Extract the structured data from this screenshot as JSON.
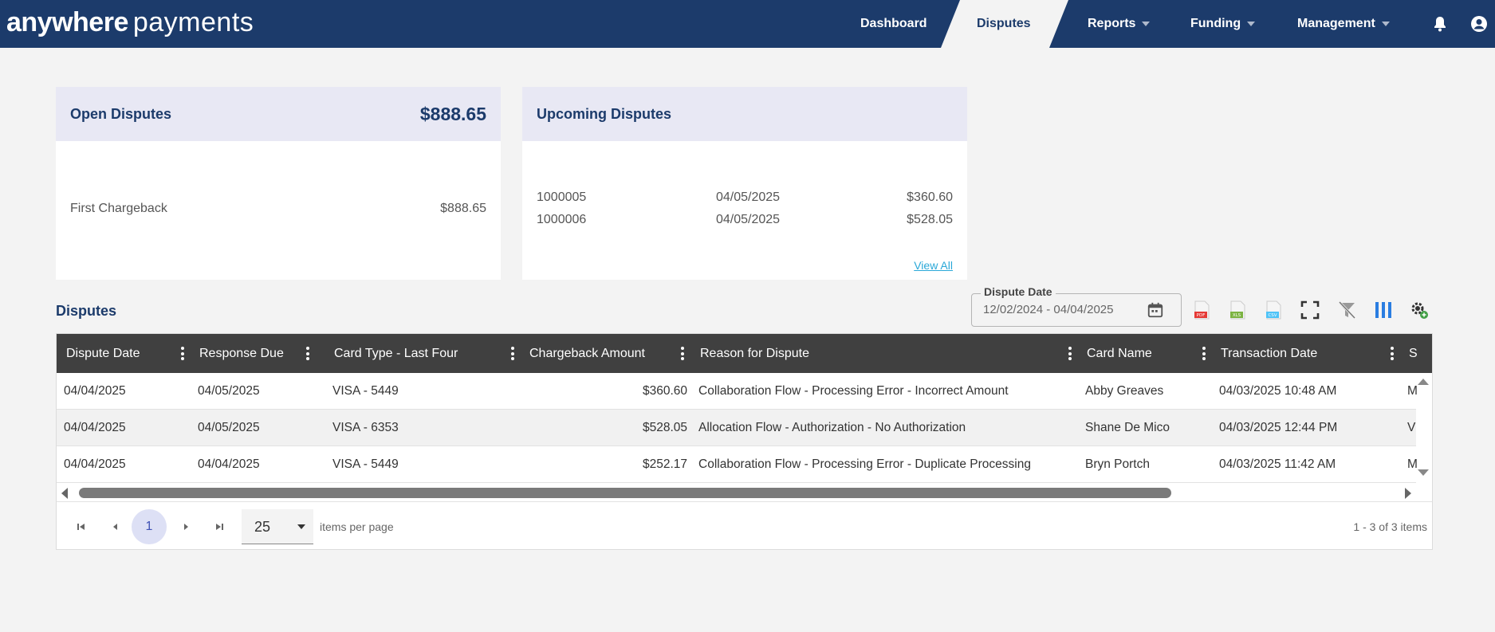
{
  "brand": {
    "bold": "anywhere",
    "light": "payments"
  },
  "nav": {
    "items": [
      {
        "label": "Dashboard"
      },
      {
        "label": "Disputes"
      },
      {
        "label": "Reports"
      },
      {
        "label": "Funding"
      },
      {
        "label": "Management"
      }
    ],
    "icons": [
      "bell-icon",
      "user-icon"
    ]
  },
  "open_disputes": {
    "title": "Open Disputes",
    "total": "$888.65",
    "rows": [
      {
        "label": "First Chargeback",
        "amount": "$888.65"
      }
    ]
  },
  "upcoming_disputes": {
    "title": "Upcoming Disputes",
    "rows": [
      {
        "id": "1000005",
        "date": "04/05/2025",
        "amount": "$360.60"
      },
      {
        "id": "1000006",
        "date": "04/05/2025",
        "amount": "$528.05"
      }
    ],
    "view_all": "View All"
  },
  "disputes": {
    "title": "Disputes",
    "date_filter": {
      "label": "Dispute Date",
      "value": "12/02/2024 - 04/04/2025"
    },
    "toolbar": [
      "pdf-export-icon",
      "xls-export-icon",
      "csv-export-icon",
      "fullscreen-icon",
      "clear-filter-icon",
      "columns-icon",
      "settings-icon"
    ],
    "columns": [
      "Dispute Date",
      "Response Due",
      "Card Type - Last Four",
      "Chargeback Amount",
      "Reason for Dispute",
      "Card Name",
      "Transaction Date",
      "S"
    ],
    "rows": [
      [
        "04/04/2025",
        "04/05/2025",
        "VISA - 5449",
        "$360.60",
        "Collaboration Flow - Processing Error - Incorrect Amount",
        "Abby Greaves",
        "04/03/2025 10:48 AM",
        "M"
      ],
      [
        "04/04/2025",
        "04/05/2025",
        "VISA - 6353",
        "$528.05",
        "Allocation Flow - Authorization - No Authorization",
        "Shane De Mico",
        "04/03/2025 12:44 PM",
        "V"
      ],
      [
        "04/04/2025",
        "04/04/2025",
        "VISA - 5449",
        "$252.17",
        "Collaboration Flow - Processing Error - Duplicate Processing",
        "Bryn Portch",
        "04/03/2025 11:42 AM",
        "M"
      ]
    ]
  },
  "pager": {
    "current_page": "1",
    "page_size": "25",
    "items_per_page_label": "items per page",
    "info": "1 - 3 of 3 items"
  },
  "colors": {
    "primary": "#1c3b6b",
    "header_bg": "#404040",
    "link": "#2aa8d8",
    "page_bg": "#f3f3f3"
  }
}
